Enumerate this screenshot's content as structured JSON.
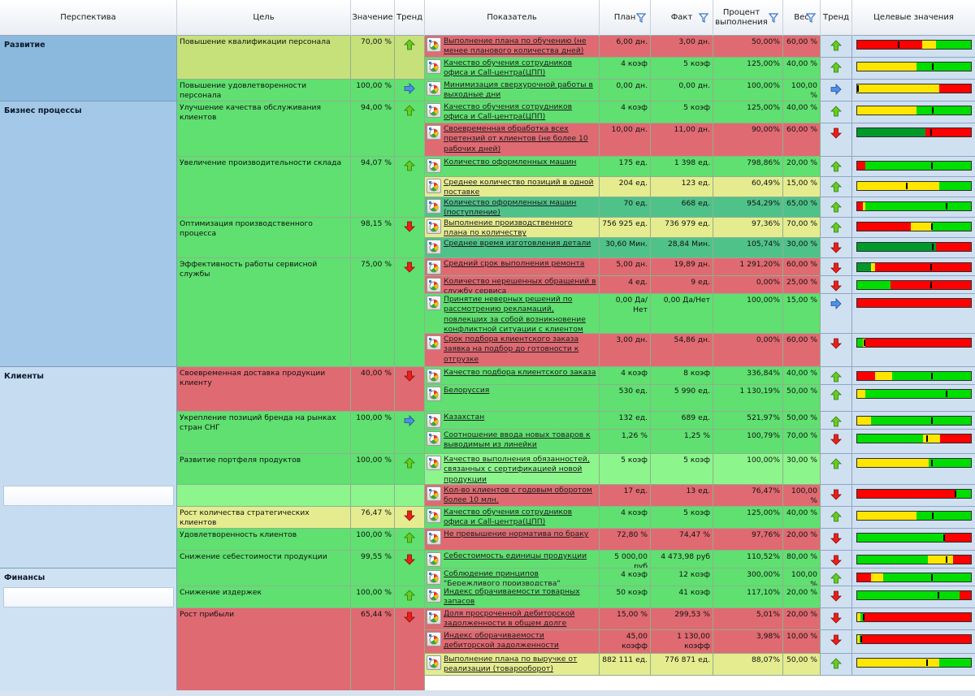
{
  "headers": {
    "perspective": "Перспектива",
    "goal": "Цель",
    "value": "Значение",
    "trend": "Тренд",
    "indicator": "Показатель",
    "plan": "План",
    "fact": "Факт",
    "percent": "Процент выполнения",
    "weight": "Вес",
    "trend2": "Тренд",
    "targets": "Целевые значения"
  },
  "colors": {
    "green": "#5fe070",
    "lightgreen": "#8cf58c",
    "red": "#e06a72",
    "yellow": "#e5ec90",
    "olive": "#c6e07a",
    "teal": "#4fc28a",
    "selected": "#ffffff"
  },
  "perspectives": [
    {
      "name": "Развитие",
      "r0": 0,
      "r1": 3,
      "bg": "#8ab9dd"
    },
    {
      "name": "Бизнес процессы",
      "r0": 3,
      "r1": 14,
      "bg": "#a4c8e7"
    },
    {
      "name": "Клиенты",
      "r0": 14,
      "r1": 23,
      "bg": "#c6dcf0"
    },
    {
      "name": "Финансы",
      "r0": 23,
      "r1": 30,
      "bg": "#cfe2f3"
    }
  ],
  "goals": [
    {
      "name": "Повышение квалификации персонала",
      "value": "70,00 %",
      "trend": "up",
      "r0": 0,
      "r1": 2,
      "color": "olive"
    },
    {
      "name": "Повышение удовлетворенности персонала",
      "value": "100,00 %",
      "trend": "right",
      "r0": 2,
      "r1": 3,
      "color": "green"
    },
    {
      "name": "Улучшение качества обслуживания клиентов",
      "value": "94,00 %",
      "trend": "up",
      "r0": 3,
      "r1": 5,
      "color": "green"
    },
    {
      "name": "Увеличение производительности склада",
      "value": "94,07 %",
      "trend": "up",
      "r0": 5,
      "r1": 8,
      "color": "green"
    },
    {
      "name": "Оптимизация производственного процесса",
      "value": "98,15 %",
      "trend": "down",
      "r0": 8,
      "r1": 10,
      "color": "green"
    },
    {
      "name": "Эффективность работы сервисной службы",
      "value": "75,00 %",
      "trend": "down",
      "r0": 10,
      "r1": 14,
      "color": "green"
    },
    {
      "name": "Своевременная доставка продукции клиенту",
      "value": "40,00 %",
      "trend": "down",
      "r0": 14,
      "r1": 16,
      "color": "red"
    },
    {
      "name": "Укрепление позиций бренда на рынках стран СНГ",
      "value": "100,00 %",
      "trend": "right",
      "r0": 16,
      "r1": 18,
      "color": "green"
    },
    {
      "name": "Развитие портфеля продуктов",
      "value": "100,00 %",
      "trend": "up",
      "r0": 18,
      "r1": 19,
      "color": "green"
    },
    {
      "name": "",
      "value": "",
      "trend": "",
      "r0": 19,
      "r1": 20,
      "color": "lightgreen"
    },
    {
      "name": "Рост количества стратегических клиентов",
      "value": "76,47 %",
      "trend": "down",
      "r0": 20,
      "r1": 21,
      "color": "yellow"
    },
    {
      "name": "Удовлетворенность клиентов",
      "value": "100,00 %",
      "trend": "up",
      "r0": 21,
      "r1": 22,
      "color": "green"
    },
    {
      "name": "Снижение себестоимости продукции",
      "value": "99,55 %",
      "trend": "down",
      "r0": 22,
      "r1": 24,
      "color": "green"
    },
    {
      "name": "Снижение издержек",
      "value": "100,00 %",
      "trend": "up",
      "r0": 24,
      "r1": 25,
      "color": "green"
    },
    {
      "name": "Рост прибыли",
      "value": "65,44 %",
      "trend": "down",
      "r0": 25,
      "r1": 30,
      "color": "red"
    }
  ],
  "rows": [
    {
      "indicator": "Выполнение плана по обучению (не менее планового количества дней)",
      "plan": "6,00 дн.",
      "fact": "3,00 дн.",
      "percent": "50,00%",
      "weight": "60,00 %",
      "trend": "up",
      "color": "red",
      "gauge": [
        [
          "r",
          57
        ],
        [
          "y",
          12
        ],
        [
          "g",
          31
        ]
      ],
      "marker": 36
    },
    {
      "indicator": "Качество обучения сотрудников офиса и Call-центра(ЦПП)",
      "plan": "4 коэф",
      "fact": "5 коэф",
      "percent": "125,00%",
      "weight": "40,00 %",
      "trend": "up",
      "color": "green",
      "gauge": [
        [
          "y",
          52
        ],
        [
          "g",
          48
        ]
      ],
      "marker": 66
    },
    {
      "indicator": "Минимизация сверхурочной работы в выходные дни",
      "plan": "0,00 дн.",
      "fact": "0,00 дн.",
      "percent": "100,00%",
      "weight": "100,00 %",
      "trend": "right",
      "color": "green",
      "gauge": [
        [
          "y",
          72
        ],
        [
          "r",
          28
        ]
      ],
      "marker": 0
    },
    {
      "indicator": "Качество обучения сотрудников офиса и Call-центра(ЦПП)",
      "plan": "4 коэф",
      "fact": "5 коэф",
      "percent": "125,00%",
      "weight": "40,00 %",
      "trend": "up",
      "color": "green",
      "gauge": [
        [
          "y",
          52
        ],
        [
          "g",
          48
        ]
      ],
      "marker": 66
    },
    {
      "indicator": "Своевременная обработка всех претензий от клиентов (не более 10 рабочих дней)",
      "plan": "10,00 дн.",
      "fact": "11,00 дн.",
      "percent": "90,00%",
      "weight": "60,00 %",
      "trend": "down",
      "color": "red",
      "gauge": [
        [
          "dg",
          60
        ],
        [
          "r",
          40
        ]
      ],
      "marker": 64
    },
    {
      "indicator": "Количество оформленных машин",
      "plan": "175 ед.",
      "fact": "1 398 ед.",
      "percent": "798,86%",
      "weight": "20,00 %",
      "trend": "up",
      "color": "green",
      "gauge": [
        [
          "r",
          7
        ],
        [
          "g",
          93
        ]
      ],
      "marker": 65
    },
    {
      "indicator": "Среднее количество позиций в одной поставке",
      "plan": "204 ед.",
      "fact": "123 ед.",
      "percent": "60,49%",
      "weight": "15,00 %",
      "trend": "up",
      "color": "yellow",
      "gauge": [
        [
          "y",
          72
        ],
        [
          "g",
          28
        ]
      ],
      "marker": 43
    },
    {
      "indicator": "Количество оформленных машин (поступление)",
      "plan": "70 ед.",
      "fact": "668 ед.",
      "percent": "954,29%",
      "weight": "65,00 %",
      "trend": "up",
      "color": "teal",
      "gauge": [
        [
          "r",
          5
        ],
        [
          "y",
          2
        ],
        [
          "g",
          93
        ]
      ],
      "marker": 78
    },
    {
      "indicator": "Выполнение производственного плана по количеству",
      "plan": "756 925 ед.",
      "fact": "736 979 ед.",
      "percent": "97,36%",
      "weight": "70,00 %",
      "trend": "up",
      "color": "yellow",
      "gauge": [
        [
          "r",
          47
        ],
        [
          "y",
          19
        ],
        [
          "g",
          34
        ]
      ],
      "marker": 65
    },
    {
      "indicator": "Среднее время изготовления детали",
      "plan": "30,60 Мин.",
      "fact": "28,84 Мин.",
      "percent": "105,74%",
      "weight": "30,00 %",
      "trend": "down",
      "color": "teal",
      "gauge": [
        [
          "dg",
          69
        ],
        [
          "r",
          31
        ]
      ],
      "marker": 66
    },
    {
      "indicator": "Средний срок выполнения ремонта",
      "plan": "5,00 дн.",
      "fact": "19,89 дн.",
      "percent": "1 291,20%",
      "weight": "60,00 %",
      "trend": "down",
      "color": "red",
      "gauge": [
        [
          "dg",
          12
        ],
        [
          "y",
          4
        ],
        [
          "r",
          84
        ]
      ],
      "marker": 64
    },
    {
      "indicator": "Количество нерешенных обращений в службу сервиса",
      "plan": "4 ед.",
      "fact": "9 ед.",
      "percent": "0,00%",
      "weight": "25,00 %",
      "trend": "down",
      "color": "red",
      "gauge": [
        [
          "g",
          29
        ],
        [
          "r",
          71
        ]
      ],
      "marker": 64
    },
    {
      "indicator": "Принятие неверных решений по рассмотрению рекламаций, повлекших за собой возникновение конфликтной ситуации с клиентом",
      "plan": "0,00 Да/Нет",
      "fact": "0,00 Да/Нет",
      "percent": "100,00%",
      "weight": "15,00 %",
      "trend": "right",
      "color": "green",
      "gauge": [
        [
          "r",
          100
        ]
      ],
      "marker": -1
    },
    {
      "indicator": "Срок подбора клиентского заказа заявка на подбор до готовности к отгрузке",
      "plan": "3,00 дн.",
      "fact": "54,86 дн.",
      "percent": "0,00%",
      "weight": "60,00 %",
      "trend": "down",
      "color": "red",
      "gauge": [
        [
          "g",
          5
        ],
        [
          "y",
          2
        ],
        [
          "r",
          93
        ]
      ],
      "marker": 6
    },
    {
      "indicator": "Качество подбора клиентского заказа",
      "plan": "4 коэф",
      "fact": "8 коэф",
      "percent": "336,84%",
      "weight": "40,00 %",
      "trend": "up",
      "color": "green",
      "gauge": [
        [
          "r",
          16
        ],
        [
          "y",
          15
        ],
        [
          "g",
          69
        ]
      ],
      "marker": 65
    },
    {
      "indicator": "Белоруссия",
      "plan": "530 ед.",
      "fact": "5 990 ед.",
      "percent": "1 130,19%",
      "weight": "50,00 %",
      "trend": "up",
      "color": "green",
      "gauge": [
        [
          "y",
          7
        ],
        [
          "g",
          93
        ]
      ],
      "marker": 78
    },
    {
      "indicator": "Казахстан",
      "plan": "132 ед.",
      "fact": "689 ед.",
      "percent": "521,97%",
      "weight": "50,00 %",
      "trend": "up",
      "color": "green",
      "gauge": [
        [
          "y",
          12
        ],
        [
          "g",
          88
        ]
      ],
      "marker": 65
    },
    {
      "indicator": "Соотношение ввода новых товаров к выводимым из линейки",
      "plan": "1,26 %",
      "fact": "1,25 %",
      "percent": "100,79%",
      "weight": "70,00 %",
      "trend": "down",
      "color": "green",
      "gauge": [
        [
          "g",
          58
        ],
        [
          "y",
          15
        ],
        [
          "r",
          27
        ]
      ],
      "marker": 61
    },
    {
      "indicator": "Качество выполнения обязанностей, связанных с сертификацией новой продукции",
      "plan": "5 коэф",
      "fact": "5 коэф",
      "percent": "100,00%",
      "weight": "30,00 %",
      "trend": "up",
      "color": "lightgreen",
      "gauge": [
        [
          "y",
          63
        ],
        [
          "g",
          37
        ]
      ],
      "marker": 65
    },
    {
      "indicator": "Кол-во клиентов с годовым оборотом более 10 млн.",
      "plan": "17 ед.",
      "fact": "13 ед.",
      "percent": "76,47%",
      "weight": "100,00 %",
      "trend": "down",
      "color": "red",
      "gauge": [
        [
          "r",
          87
        ],
        [
          "g",
          13
        ]
      ],
      "marker": 86
    },
    {
      "indicator": "Качество обучения сотрудников офиса и Call-центра(ЦПП)",
      "plan": "4 коэф",
      "fact": "5 коэф",
      "percent": "125,00%",
      "weight": "40,00 %",
      "trend": "up",
      "color": "green",
      "gauge": [
        [
          "y",
          52
        ],
        [
          "g",
          48
        ]
      ],
      "marker": 66
    },
    {
      "indicator": "Не превышение норматива по браку",
      "plan": "72,80 %",
      "fact": "74,47 %",
      "percent": "97,76%",
      "weight": "20,00 %",
      "trend": "down",
      "color": "red",
      "gauge": [
        [
          "g",
          77
        ],
        [
          "r",
          23
        ]
      ],
      "marker": 76
    },
    {
      "indicator": "Себестоимость единицы продукции",
      "plan": "5 000,00 руб",
      "fact": "4 473,98 руб",
      "percent": "110,52%",
      "weight": "80,00 %",
      "trend": "down",
      "color": "green",
      "gauge": [
        [
          "g",
          62
        ],
        [
          "y",
          22
        ],
        [
          "r",
          16
        ]
      ],
      "marker": 78
    },
    {
      "indicator": "Соблюдение принципов \"Бережливого производства\"",
      "plan": "4 коэф",
      "fact": "12 коэф",
      "percent": "300,00%",
      "weight": "100,00 %",
      "trend": "up",
      "color": "green",
      "gauge": [
        [
          "r",
          12
        ],
        [
          "y",
          11
        ],
        [
          "g",
          77
        ]
      ],
      "marker": 65
    },
    {
      "indicator": "Индекс обрачиваемости товарных запасов",
      "plan": "50 коэф",
      "fact": "41 коэф",
      "percent": "117,10%",
      "weight": "20,00 %",
      "trend": "down",
      "color": "green",
      "gauge": [
        [
          "g",
          90
        ],
        [
          "r",
          10
        ]
      ],
      "marker": 71
    },
    {
      "indicator": "Доля просроченной дебиторской задолженности в общем долге",
      "plan": "15,00 %",
      "fact": "299,53 %",
      "percent": "5,01%",
      "weight": "20,00 %",
      "trend": "down",
      "color": "red",
      "gauge": [
        [
          "y",
          3
        ],
        [
          "g",
          3
        ],
        [
          "r",
          94
        ]
      ],
      "marker": 5
    },
    {
      "indicator": "Индекс оборачиваемости дебиторской задолженности",
      "plan": "45,00 коэфф",
      "fact": "1 130,00 коэфф",
      "percent": "3,98%",
      "weight": "10,00 %",
      "trend": "down",
      "color": "red",
      "gauge": [
        [
          "y",
          2
        ],
        [
          "g",
          2
        ],
        [
          "r",
          96
        ]
      ],
      "marker": 3
    },
    {
      "indicator": "Выполнение плана по выручке от реализации (товарооборот)",
      "plan": "882 111 ед.",
      "fact": "776 871 ед.",
      "percent": "88,07%",
      "weight": "50,00 %",
      "trend": "up",
      "color": "yellow",
      "gauge": [
        [
          "y",
          72
        ],
        [
          "g",
          28
        ]
      ],
      "marker": 61
    }
  ]
}
